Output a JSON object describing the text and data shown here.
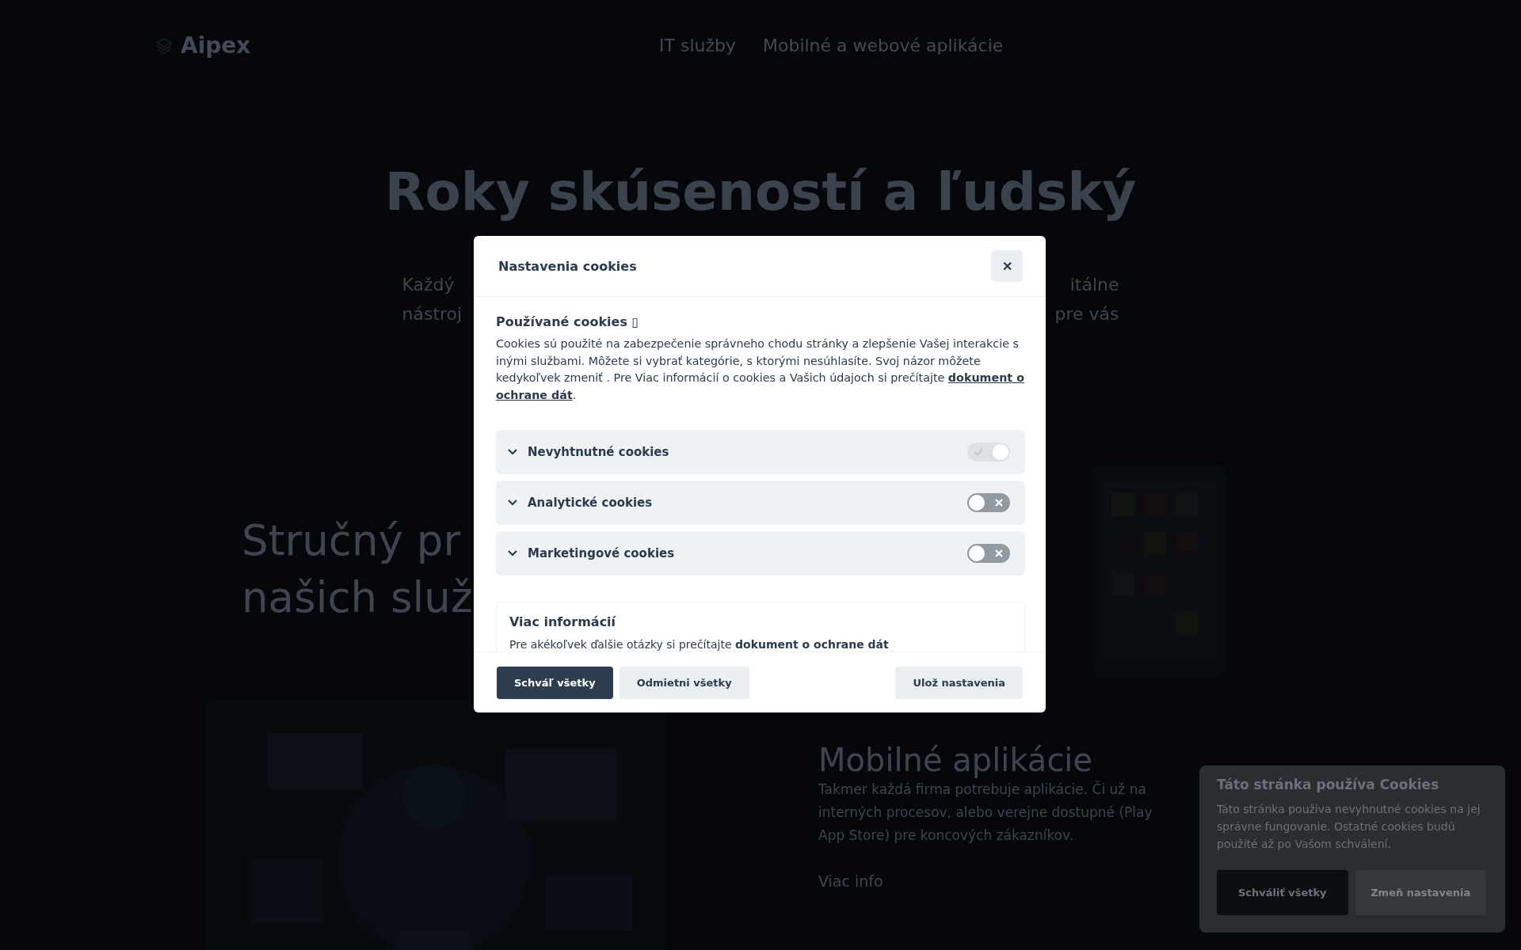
{
  "header": {
    "logo": "Aipex",
    "nav": [
      {
        "label": "IT služby"
      },
      {
        "label": "Mobilné a webové aplikácie"
      }
    ]
  },
  "hero": {
    "title_lines": [
      "Roky skúseností a ľudský"
    ],
    "subtitle_lines": [
      {
        "left": "Každý",
        "right": "itálne"
      },
      {
        "left": "nástroj",
        "right": "pre vás"
      }
    ]
  },
  "overview": {
    "title_lines": [
      "Stručný pr",
      "našich služ"
    ],
    "illustration": {
      "kind": "picture"
    }
  },
  "mobile": {
    "picture": {
      "kind": "picture"
    },
    "title": "Mobilné aplikácie",
    "text_lines": [
      "Takmer každá firma potrebuje aplikácie. Či už na",
      "interných procesov, alebo verejne dostupné (Play",
      "App Store) pre koncových zákazníkov."
    ],
    "link": "Viac info"
  },
  "cookie_banner": {
    "title": "Táto stránka používa Cookies",
    "text": "Táto stránka používa nevyhnutné cookies na jej správne fungovanie. Ostatné cookies budú použité až po Vašom schválení.",
    "buttons": [
      {
        "label": "Schváliť všetky",
        "kind": "primary"
      },
      {
        "label": "Zmeň nastavenia",
        "kind": "secondary"
      }
    ]
  },
  "modal": {
    "title": "Nastavenia cookies",
    "close": "✕",
    "section_title": "Používané cookies ▯",
    "section_text": "Cookies sú použité na zabezpečenie správneho chodu stránky a zlepšenie Vašej interakcie s inými službami. Môžete si vybrať kategórie, s ktorými nesúhlasíte. Svoj názor môžete kedykoľvek zmeniť . Pre Viac informácií o cookies a Vašich údajoch si prečítajte **dokument o ochrane dát**.",
    "categories": [
      {
        "label": "Nevyhtnutné cookies",
        "checked": true,
        "disabled": true
      },
      {
        "label": "Analytické cookies",
        "checked": false,
        "disabled": false
      },
      {
        "label": "Marketingové cookies",
        "checked": false,
        "disabled": false
      }
    ],
    "more_title": "Viac informácií",
    "more_text": "Pre akékoľvek ďalšie otázky si prečítajte **dokument o ochrane dát**",
    "buttons": [
      {
        "label": "Schváľ všetky",
        "kind": "primary"
      },
      {
        "label": "Odmietni všetky",
        "kind": "secondary"
      },
      {
        "label": "Ulož nastavenia",
        "kind": "secondary"
      }
    ]
  }
}
